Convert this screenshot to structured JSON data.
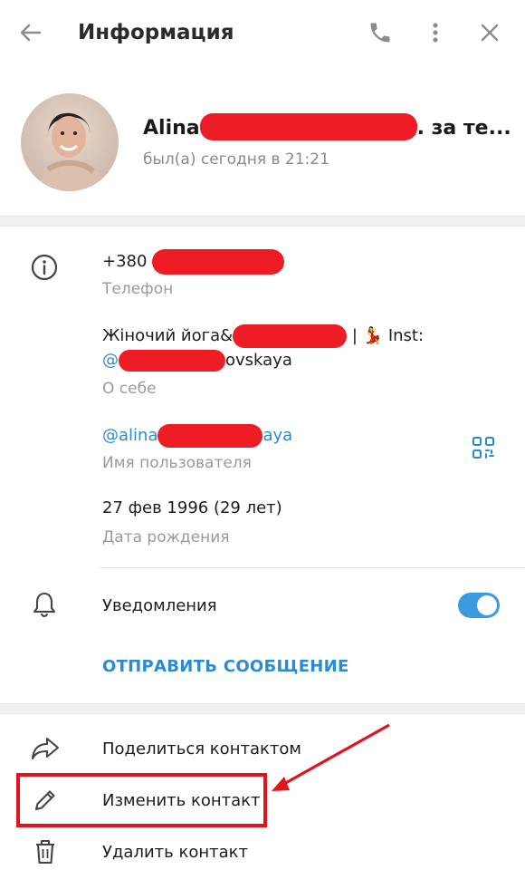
{
  "header": {
    "title": "Информация",
    "back_icon": "arrow-left-icon",
    "call_icon": "phone-icon",
    "menu_icon": "more-vertical-icon",
    "close_icon": "close-icon"
  },
  "profile": {
    "name_prefix": "Alina",
    "name_suffix": ". за те...",
    "status": "был(а) сегодня в 21:21"
  },
  "info": {
    "phone": {
      "value_prefix": "+380",
      "label": "Телефон"
    },
    "bio": {
      "line1_prefix": "Жіночий йога&",
      "line1_suffix": " | ",
      "line1_emoji": "💃",
      "line1_end": " Inst:",
      "line2_prefix": "@",
      "line2_suffix": "ovskaya",
      "label": "О себе"
    },
    "username": {
      "value_prefix": "@alina",
      "value_suffix": "aya",
      "label": "Имя пользователя"
    },
    "birthday": {
      "value": "27 фев 1996 (29 лет)",
      "label": "Дата рождения"
    }
  },
  "notifications": {
    "label": "Уведомления",
    "enabled": true
  },
  "send_message_label": "ОТПРАВИТЬ СООБЩЕНИЕ",
  "actions": [
    {
      "label": "Поделиться контактом",
      "icon": "share-icon"
    },
    {
      "label": "Изменить контакт",
      "icon": "pencil-icon"
    },
    {
      "label": "Удалить контакт",
      "icon": "trash-icon"
    }
  ],
  "colors": {
    "accent": "#2a8bd1",
    "toggle_on": "#3b9ae0",
    "redaction": "#ee1c25",
    "annotation": "#e2131c"
  }
}
